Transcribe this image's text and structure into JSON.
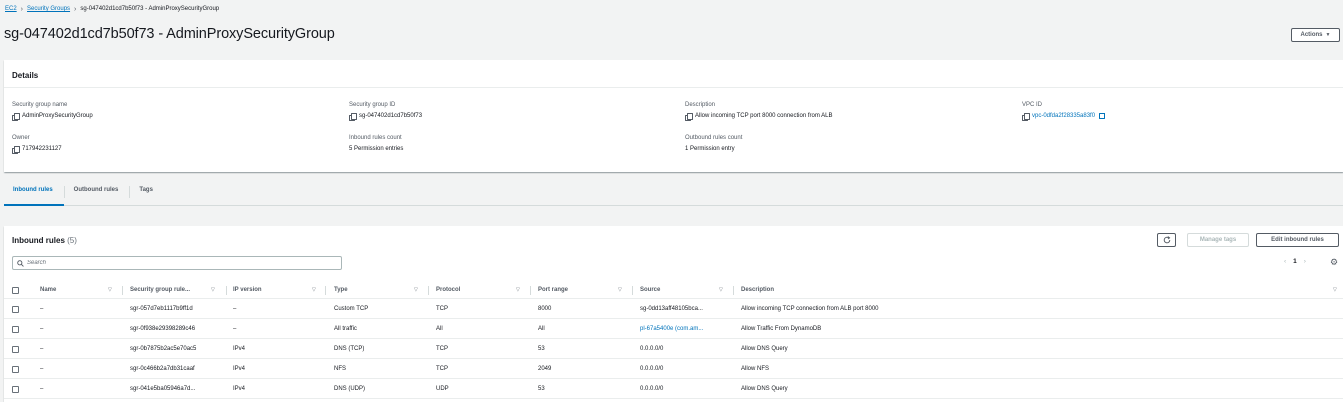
{
  "breadcrumb": {
    "ec2": "EC2",
    "security_groups": "Security Groups",
    "current": "sg-047402d1cd7b50f73 - AdminProxySecurityGroup"
  },
  "page_title": "sg-047402d1cd7b50f73 - AdminProxySecurityGroup",
  "actions_label": "Actions",
  "details": {
    "heading": "Details",
    "sg_name_label": "Security group name",
    "sg_name_value": "AdminProxySecurityGroup",
    "sg_id_label": "Security group ID",
    "sg_id_value": "sg-047402d1cd7b50f73",
    "description_label": "Description",
    "description_value": "Allow incoming TCP port 8000 connection from ALB",
    "vpc_label": "VPC ID",
    "vpc_value": "vpc-0dfda2f28335a83f0",
    "owner_label": "Owner",
    "owner_value": "717942231127",
    "inbound_count_label": "Inbound rules count",
    "inbound_count_value": "5 Permission entries",
    "outbound_count_label": "Outbound rules count",
    "outbound_count_value": "1 Permission entry"
  },
  "tabs": [
    {
      "label": "Inbound rules",
      "active": true
    },
    {
      "label": "Outbound rules",
      "active": false
    },
    {
      "label": "Tags",
      "active": false
    }
  ],
  "rules": {
    "title": "Inbound rules",
    "count": "(5)",
    "manage_tags_label": "Manage tags",
    "edit_label": "Edit inbound rules",
    "search_placeholder": "Search",
    "page": "1",
    "columns": {
      "name": "Name",
      "rule_id": "Security group rule...",
      "ip_version": "IP version",
      "type": "Type",
      "protocol": "Protocol",
      "port_range": "Port range",
      "source": "Source",
      "description": "Description"
    },
    "rows": [
      {
        "name": "–",
        "rule_id": "sgr-057d7eb1117b9ff1d",
        "ip_version": "–",
        "type": "Custom TCP",
        "protocol": "TCP",
        "port_range": "8000",
        "source": "sg-0dd13aff48105bca...",
        "description": "Allow incoming TCP connection from ALB port 8000"
      },
      {
        "name": "–",
        "rule_id": "sgr-0f938e29398289c46",
        "ip_version": "–",
        "type": "All traffic",
        "protocol": "All",
        "port_range": "All",
        "source": "pl-67a5400e (com.am...",
        "description": "Allow Traffic From DynamoDB"
      },
      {
        "name": "–",
        "rule_id": "sgr-0b7875b2ac5e70ac5",
        "ip_version": "IPv4",
        "type": "DNS (TCP)",
        "protocol": "TCP",
        "port_range": "53",
        "source": "0.0.0.0/0",
        "description": "Allow DNS Query"
      },
      {
        "name": "–",
        "rule_id": "sgr-0c466b2a7db31caaf",
        "ip_version": "IPv4",
        "type": "NFS",
        "protocol": "TCP",
        "port_range": "2049",
        "source": "0.0.0.0/0",
        "description": "Allow NFS"
      },
      {
        "name": "–",
        "rule_id": "sgr-041e5ba05946a7d...",
        "ip_version": "IPv4",
        "type": "DNS (UDP)",
        "protocol": "UDP",
        "port_range": "53",
        "source": "0.0.0.0/0",
        "description": "Allow DNS Query"
      }
    ]
  },
  "colors": {
    "link": "#0073bb",
    "text": "#16191f",
    "muted": "#545b64",
    "background": "#f2f3f3"
  }
}
